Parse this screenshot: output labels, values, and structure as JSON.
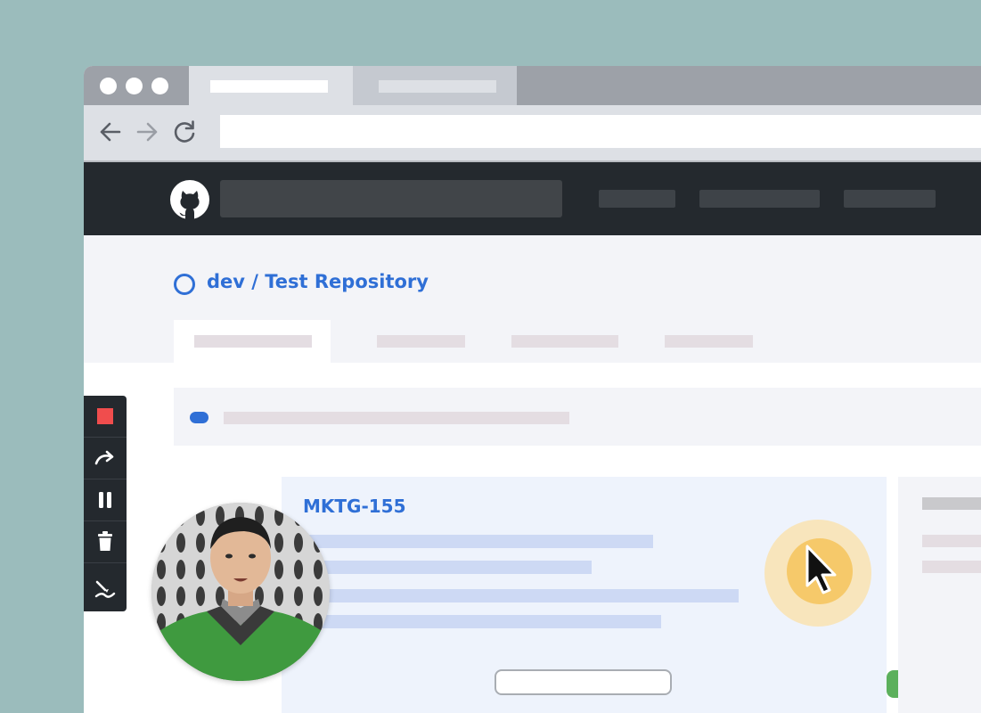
{
  "repo": {
    "title": "dev / Test Repository"
  },
  "card": {
    "title": "MKTG-155"
  },
  "icons": {
    "back": "arrow-left-icon",
    "forward": "arrow-right-icon",
    "reload": "reload-icon",
    "logo": "github-logo-icon",
    "repo": "repo-circle-icon",
    "cursor": "mouse-pointer-icon",
    "stop": "stop-icon",
    "restart": "redo-arrow-icon",
    "pause": "pause-icon",
    "delete": "trash-icon",
    "draw": "pen-draw-icon"
  },
  "colors": {
    "background": "#9bbcbc",
    "accent": "#2f6fd6",
    "header": "#24292e",
    "primary_button": "#5cb05c",
    "record": "#f04d4d",
    "highlight": "#f6c96a"
  }
}
